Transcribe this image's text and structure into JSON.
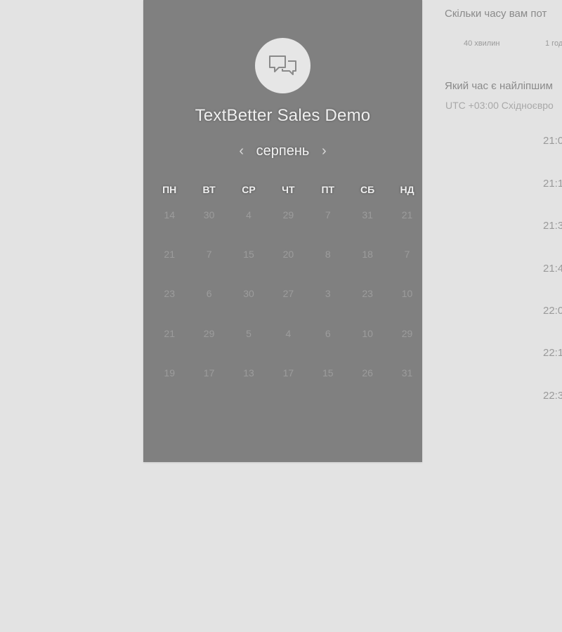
{
  "header": {
    "title": "TextBetter Sales Demo",
    "logo_icon": "chat-bubbles-icon"
  },
  "calendar": {
    "month": "серпень",
    "prev_icon": "‹",
    "next_icon": "›",
    "weekdays": [
      "ПН",
      "ВТ",
      "СР",
      "ЧТ",
      "ПТ",
      "СБ",
      "НД"
    ],
    "weeks": [
      [
        "14",
        "30",
        "4",
        "29",
        "7",
        "31",
        "21"
      ],
      [
        "21",
        "7",
        "15",
        "20",
        "8",
        "18",
        "7"
      ],
      [
        "23",
        "6",
        "30",
        "27",
        "3",
        "23",
        "10"
      ],
      [
        "21",
        "29",
        "5",
        "4",
        "6",
        "10",
        "29"
      ],
      [
        "19",
        "17",
        "13",
        "17",
        "15",
        "26",
        "31"
      ]
    ]
  },
  "booking": {
    "duration_question": "Скільки часу вам пот",
    "durations": [
      "40 хвилин",
      "1 год"
    ],
    "time_question": "Який час є найліпшим",
    "timezone": "UTC +03:00 Східноєвро",
    "times": [
      "21:0",
      "21:1",
      "21:3",
      "21:4",
      "22:0",
      "22:1",
      "22:3"
    ]
  },
  "colors": {
    "page_bg": "#e3e3e3",
    "panel_bg": "#808080",
    "logo_bg": "#e6e6e6"
  }
}
